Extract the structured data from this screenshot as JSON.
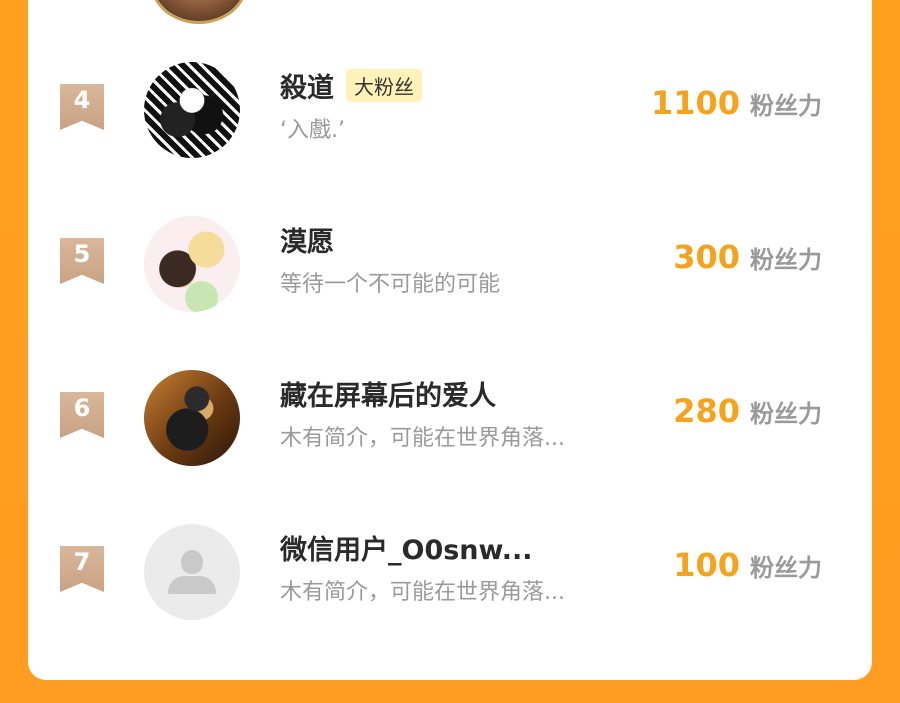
{
  "rank_list": {
    "items": [
      {
        "rank": "4",
        "name": "殺道",
        "badge": "大粉丝",
        "bio": "‘入戲.’",
        "score": "1100",
        "unit": "粉丝力",
        "avatar": "dark-manga-avatar"
      },
      {
        "rank": "5",
        "name": "漠愿",
        "badge": "",
        "bio": "等待一个不可能的可能",
        "score": "300",
        "unit": "粉丝力",
        "avatar": "pink-anime-avatar"
      },
      {
        "rank": "6",
        "name": "藏在屏幕后的爱人",
        "badge": "",
        "bio": "木有简介，可能在世界角落...",
        "score": "280",
        "unit": "粉丝力",
        "avatar": "couple-avatar"
      },
      {
        "rank": "7",
        "name": "微信用户_O0snw...",
        "badge": "",
        "bio": "木有简介，可能在世界角落...",
        "score": "100",
        "unit": "粉丝力",
        "avatar": "default-user-avatar"
      }
    ]
  },
  "colors": {
    "background": "#ff9c22",
    "score": "#f5a31e",
    "rank_ribbon": "#d2ad8f",
    "badge_bg": "#fff2b8"
  }
}
